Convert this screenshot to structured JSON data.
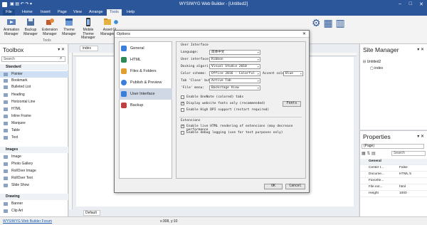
{
  "window": {
    "title": "WYSIWYG Web Builder - [Untitled2]"
  },
  "menu": [
    "File",
    "Home",
    "Insert",
    "Page",
    "View",
    "Arrange",
    "Tools",
    "Help"
  ],
  "menu_active": "Tools",
  "ribbon": {
    "buttons": [
      {
        "label": "Animation Manager",
        "icon": "animation-icon"
      },
      {
        "label": "Backup Manager",
        "icon": "backup-icon"
      },
      {
        "label": "Extension Manager",
        "icon": "extension-icon"
      },
      {
        "label": "Theme Manager",
        "icon": "theme-icon"
      },
      {
        "label": "Mobile Theme Manager",
        "icon": "mobile-theme-icon"
      },
      {
        "label": "Asset Manager",
        "icon": "asset-icon"
      },
      {
        "label": "Gl...",
        "icon": "global-icon"
      }
    ],
    "group_label": "Tools"
  },
  "toolbox": {
    "title": "Toolbox",
    "search_placeholder": "Search",
    "categories": [
      {
        "name": "Standard",
        "items": [
          "Pointer",
          "Bookmark",
          "Bulleted List",
          "Heading",
          "Horizontal Line",
          "HTML",
          "Inline Frame",
          "Marquee",
          "Table",
          "Text"
        ]
      },
      {
        "name": "Images",
        "items": [
          "Image",
          "Photo Gallery",
          "RollOver Image",
          "RollOver Text",
          "Slide Show"
        ]
      },
      {
        "name": "Drawing",
        "items": [
          "Banner",
          "Clip Art"
        ]
      }
    ]
  },
  "canvas": {
    "tab": "index",
    "page_tab": "Default"
  },
  "site_manager": {
    "title": "Site Manager",
    "root": "Untitled2",
    "page": "index"
  },
  "properties": {
    "title": "Properties",
    "selection": "(Page)",
    "search_placeholder": "Search",
    "section": "General",
    "rows": [
      {
        "key": "Center I...",
        "value": "False"
      },
      {
        "key": "Docume...",
        "value": "HTML 5"
      },
      {
        "key": "Favorite...",
        "value": ""
      },
      {
        "key": "File ext...",
        "value": "html"
      },
      {
        "key": "Height",
        "value": "1000"
      }
    ]
  },
  "dialog": {
    "title": "Options",
    "nav": [
      {
        "label": "General",
        "icon": "general-icon",
        "color": "#3b7dd8"
      },
      {
        "label": "HTML",
        "icon": "html-icon",
        "color": "#2e8b57"
      },
      {
        "label": "Files & Folders",
        "icon": "folder-icon",
        "color": "#e0a030"
      },
      {
        "label": "Publish & Preview",
        "icon": "publish-icon",
        "color": "#3b7dd8"
      },
      {
        "label": "User Interface",
        "icon": "ui-icon",
        "color": "#3b7dd8"
      },
      {
        "label": "Backup",
        "icon": "backup-icon",
        "color": "#c04040"
      }
    ],
    "selected_nav": "User Interface",
    "section_user_interface": "User Interface",
    "fields": {
      "language_label": "Language:",
      "language_value": "简体中文",
      "user_interface_label": "User interface:",
      "user_interface_value": "Ribbon",
      "docking_label": "Docking algori",
      "docking_value": "Visual Studio 2010",
      "color_scheme_label": "Color scheme:",
      "color_scheme_value": "Office 2016 - Colorful",
      "accent_label": "Accent colo",
      "accent_value": "Blue",
      "tab_close_label": "Tab 'Close' but",
      "tab_close_value": "Active Tab",
      "file_menu_label": "'File' menu:",
      "file_menu_value": "Backstage View"
    },
    "checks": [
      {
        "label": "Enable OneNote (colored) tabs",
        "checked": false
      },
      {
        "label": "Display website fonts only (recommended)",
        "checked": true
      },
      {
        "label": "Enable High DPI support (restart required)",
        "checked": false
      }
    ],
    "fonts_button": "Fonts",
    "section_extensions": "Extensions",
    "ext_checks": [
      {
        "label": "Enable live HTML rendering of extensions (may decrease performance",
        "checked": true
      },
      {
        "label": "Enable debug logging (use for test purposes only)",
        "checked": false
      }
    ],
    "ok": "OK",
    "cancel": "Cancel"
  },
  "status": {
    "forum": "WYSIWYG Web Builder Forum",
    "coords": "x:308, y:10"
  }
}
